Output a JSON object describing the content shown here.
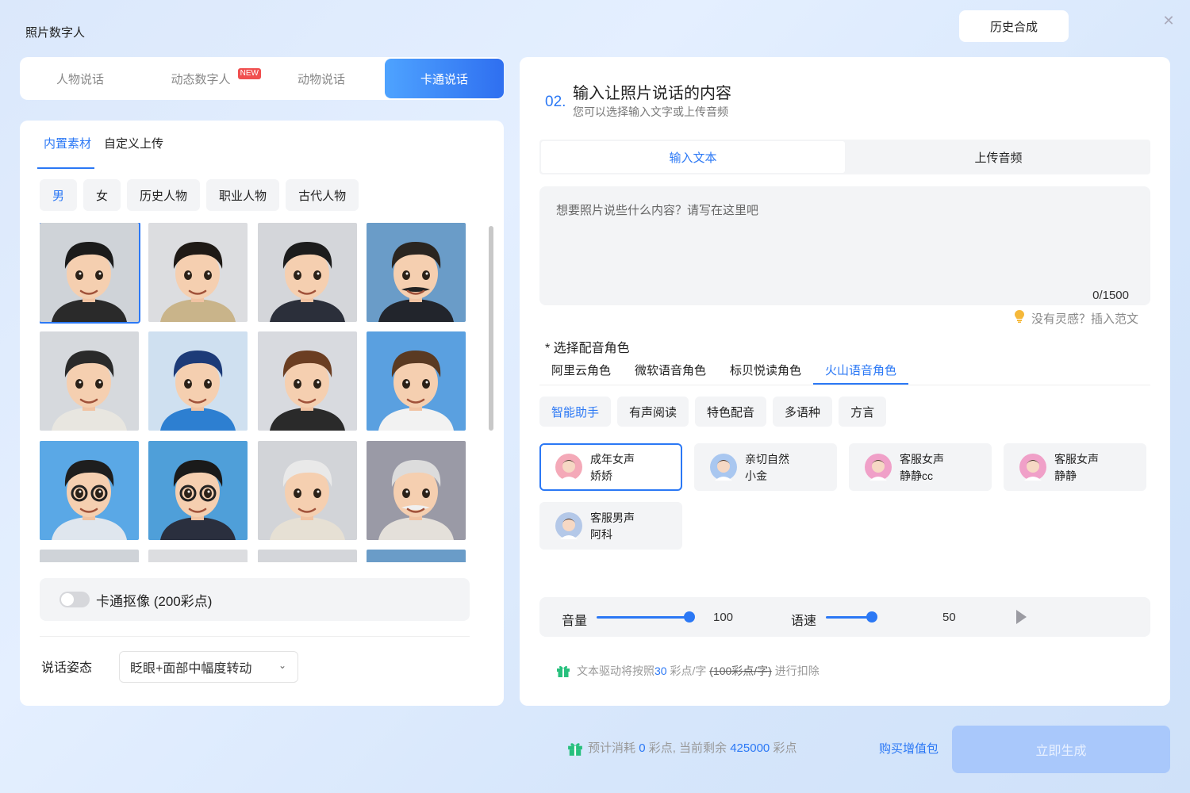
{
  "app": {
    "title": "照片数字人",
    "history_label": "历史合成"
  },
  "mode_tabs": [
    {
      "label": "人物说话"
    },
    {
      "label": "动态数字人",
      "badge": "NEW"
    },
    {
      "label": "动物说话"
    },
    {
      "label": "卡通说话",
      "active": true
    }
  ],
  "left": {
    "source_tabs": [
      {
        "label": "内置素材",
        "active": true
      },
      {
        "label": "自定义上传"
      }
    ],
    "categories": [
      {
        "label": "男",
        "active": true
      },
      {
        "label": "女"
      },
      {
        "label": "历史人物"
      },
      {
        "label": "职业人物"
      },
      {
        "label": "古代人物"
      }
    ],
    "avatars": [
      {
        "name": "black-hair-boy-mandarin-jacket",
        "selected": true
      },
      {
        "name": "boy-yellow-vest"
      },
      {
        "name": "boy-suit-red-tie"
      },
      {
        "name": "mustache-man-blue-bg"
      },
      {
        "name": "man-white-shirt"
      },
      {
        "name": "blue-hair-boy-hoodie"
      },
      {
        "name": "brown-hair-man-suit"
      },
      {
        "name": "full-body-man-blue-bg"
      },
      {
        "name": "glasses-man-blue-bg"
      },
      {
        "name": "glasses-boy-red-tie"
      },
      {
        "name": "old-man-smiling"
      },
      {
        "name": "old-man-white-mustache"
      }
    ],
    "cutout_label": "卡通抠像 (200彩点)",
    "pose_label": "说话姿态",
    "pose_value": "眨眼+面部中幅度转动"
  },
  "right": {
    "step_num": "02.",
    "step_title": "输入让照片说话的内容",
    "step_subtitle": "您可以选择输入文字或上传音频",
    "input_tabs": [
      {
        "label": "输入文本",
        "active": true
      },
      {
        "label": "上传音频"
      }
    ],
    "textarea_placeholder": "想要照片说些什么内容？请写在这里吧",
    "char_count": "0/1500",
    "inspire_label": "没有灵感？插入范文",
    "voice_title": "* 选择配音角色",
    "providers": [
      {
        "label": "阿里云角色"
      },
      {
        "label": "微软语音角色"
      },
      {
        "label": "标贝悦读角色"
      },
      {
        "label": "火山语音角色",
        "active": true
      }
    ],
    "voice_categories": [
      {
        "label": "智能助手",
        "active": true
      },
      {
        "label": "有声阅读"
      },
      {
        "label": "特色配音"
      },
      {
        "label": "多语种"
      },
      {
        "label": "方言"
      }
    ],
    "voices": [
      {
        "line1": "成年女声",
        "line2": "娇娇",
        "selected": true,
        "color": "#f4a9b8"
      },
      {
        "line1": "亲切自然",
        "line2": "小金",
        "color": "#a9c7f0"
      },
      {
        "line1": "客服女声",
        "line2": "静静cc",
        "color": "#f0a0c8"
      },
      {
        "line1": "客服女声",
        "line2": "静静",
        "color": "#f0a0c8"
      },
      {
        "line1": "客服男声",
        "line2": "阿科",
        "color": "#b4c8e8"
      }
    ],
    "volume_label": "音量",
    "volume_value": "100",
    "volume_fraction": 1.0,
    "speed_label": "语速",
    "speed_value": "50",
    "speed_fraction": 1.0,
    "cost_prefix": "文本驱动将按照",
    "cost_rate": "30",
    "cost_unit": "彩点/字",
    "cost_old": "(100彩点/字)",
    "cost_suffix": "进行扣除"
  },
  "footer": {
    "estimate_prefix": "预计消耗",
    "estimate_value": "0",
    "estimate_mid": "彩点, 当前剩余",
    "balance_value": "425000",
    "estimate_suffix": "彩点",
    "buy_label": "购买增值包",
    "generate_label": "立即生成"
  },
  "colors": {
    "accent": "#2b78f5",
    "generate_disabled": "#a9c8fb"
  }
}
